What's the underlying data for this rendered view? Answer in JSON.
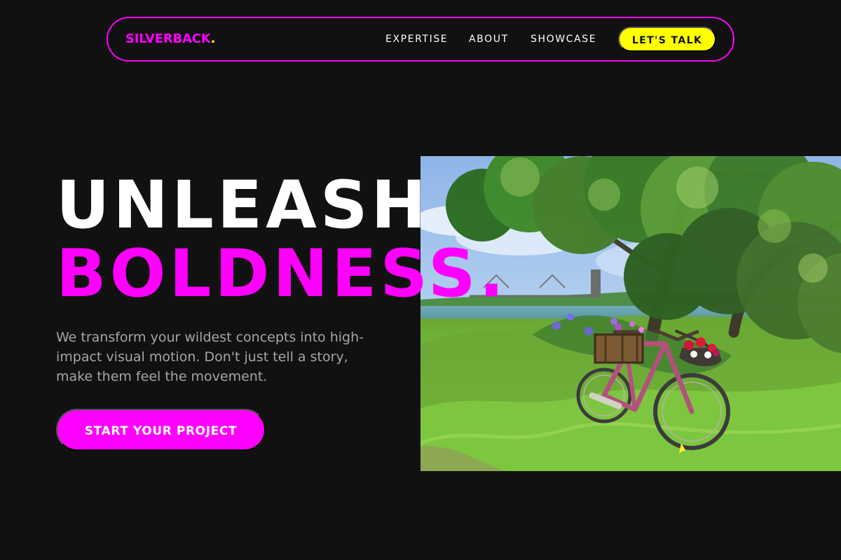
{
  "brand": {
    "name": "SILVERBACK",
    "dot": ".",
    "primary_color": "#ff00ff",
    "accent_color": "#ffff00",
    "background_color": "#111111"
  },
  "nav": {
    "links": [
      {
        "label": "EXPERTISE"
      },
      {
        "label": "ABOUT"
      },
      {
        "label": "SHOWCASE"
      }
    ],
    "cta_label": "LET'S TALK"
  },
  "hero": {
    "title_line_1": "UNLEASH",
    "title_line_2": "BOLDNESS.",
    "description": "We transform your wildest concepts into high-impact visual motion. Don't just tell a story, make them feel the movement.",
    "cta_label": "START YOUR PROJECT"
  }
}
